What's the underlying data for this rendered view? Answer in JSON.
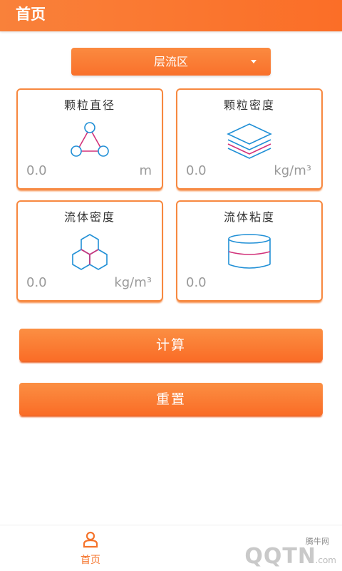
{
  "header": {
    "title": "首页"
  },
  "flow_select": {
    "selected": "层流区"
  },
  "cards": [
    {
      "title": "颗粒直径",
      "value": "0.0",
      "unit": "m",
      "icon": "triangle-nodes-icon"
    },
    {
      "title": "颗粒密度",
      "value": "0.0",
      "unit": "kg/m³",
      "icon": "stacked-layers-icon"
    },
    {
      "title": "流体密度",
      "value": "0.0",
      "unit": "kg/m³",
      "icon": "hexagon-cluster-icon"
    },
    {
      "title": "流体粘度",
      "value": "0.0",
      "unit": "",
      "icon": "cylinder-icon"
    }
  ],
  "actions": {
    "calculate": "计算",
    "reset": "重置"
  },
  "nav": {
    "home_label": "首页"
  },
  "watermark": {
    "brand": "腾牛网",
    "logo": "QQTN",
    "suffix": ".com"
  },
  "colors": {
    "accent": "#f97a33",
    "icon_blue": "#1f8fd6",
    "icon_pink": "#d2327a"
  }
}
